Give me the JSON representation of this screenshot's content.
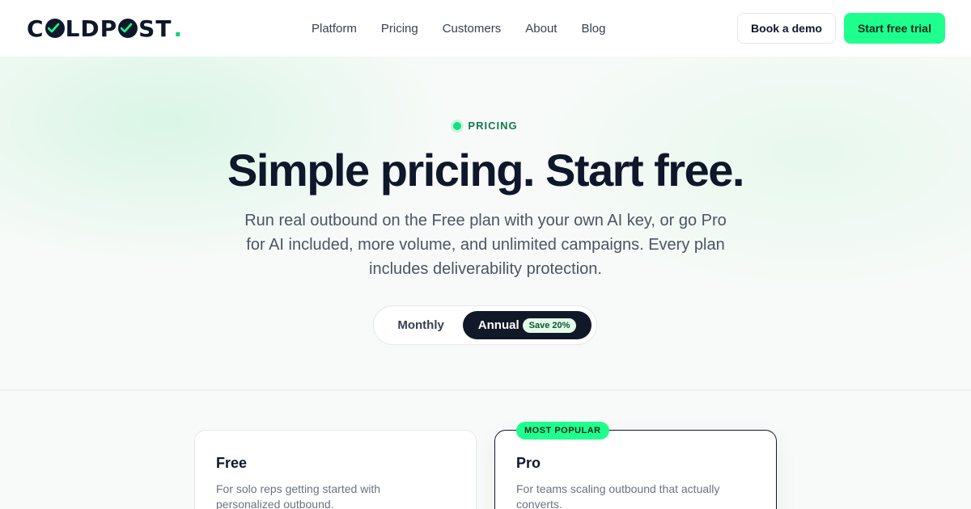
{
  "brand": {
    "left": "C",
    "right": "LDP",
    "tail": "ST",
    "dot": ".",
    "accent": "#1eff8e"
  },
  "nav": [
    "Platform",
    "Pricing",
    "Customers",
    "About",
    "Blog"
  ],
  "header": {
    "demo_label": "Book a demo",
    "trial_label": "Start free trial"
  },
  "hero": {
    "eyebrow": "PRICING",
    "title": "Simple pricing. Start free.",
    "subtitle": "Run real outbound on the Free plan with your own AI key, or go Pro for AI included, more volume, and unlimited campaigns. Every plan includes deliverability protection."
  },
  "billing_toggle": {
    "monthly": "Monthly",
    "annual": "Annual",
    "save_badge": "Save 20%",
    "selected": "Annual"
  },
  "plans": [
    {
      "name": "Free",
      "description": "For solo reps getting started with personalized outbound."
    },
    {
      "name": "Pro",
      "badge": "MOST POPULAR",
      "description": "For teams scaling outbound that actually converts."
    }
  ]
}
